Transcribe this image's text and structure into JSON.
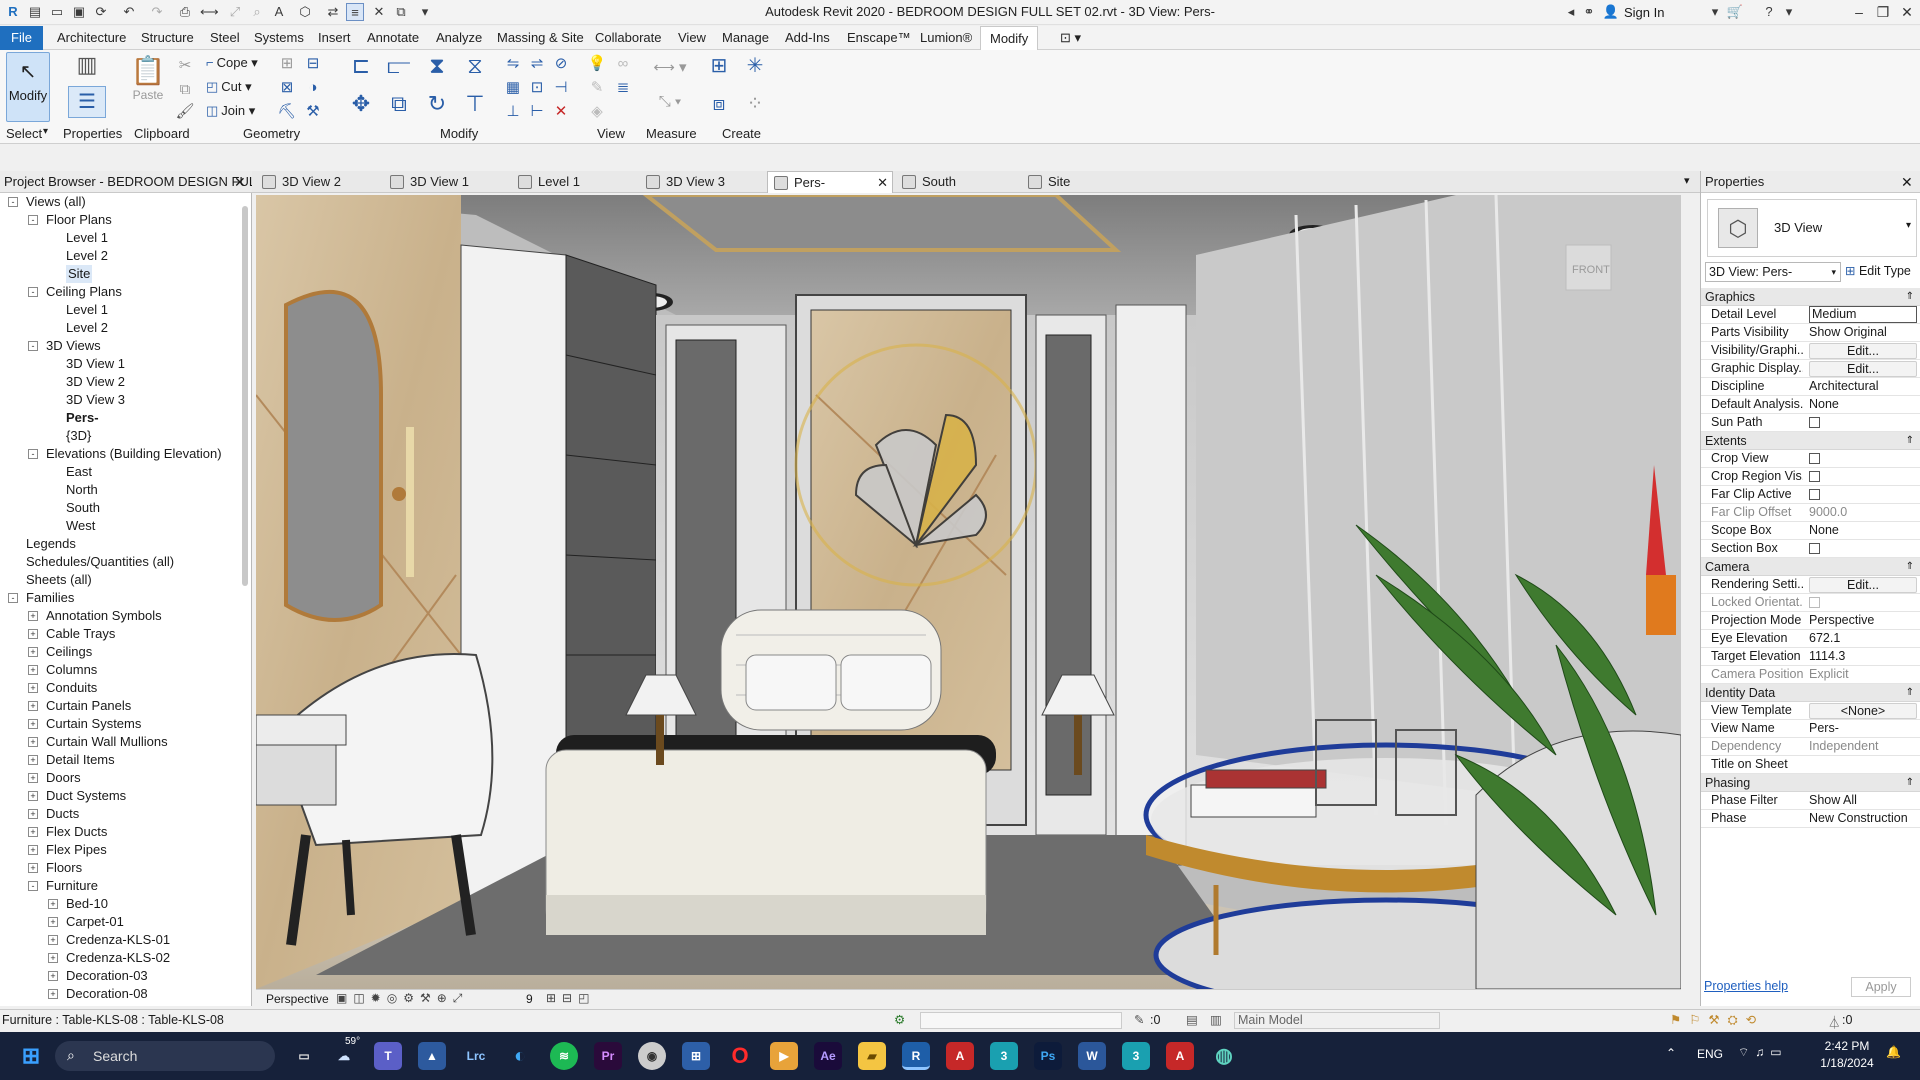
{
  "app": {
    "title": "Autodesk Revit 2020 - BEDROOM DESIGN FULL SET 02.rvt - 3D View: Pers-",
    "sign_in": "Sign In"
  },
  "ribbon": {
    "tabs": [
      "File",
      "Architecture",
      "Structure",
      "Steel",
      "Systems",
      "Insert",
      "Annotate",
      "Analyze",
      "Massing & Site",
      "Collaborate",
      "View",
      "Manage",
      "Add-Ins",
      "Enscape™",
      "Lumion®",
      "Modify"
    ],
    "active_tab": "Modify",
    "modify_label": "Modify",
    "paste_label": "Paste",
    "properties_label": "Properties",
    "cope": "Cope",
    "cut": "Cut",
    "join": "Join",
    "panels": {
      "select": "Select",
      "properties": "Properties",
      "clipboard": "Clipboard",
      "geometry": "Geometry",
      "modify": "Modify",
      "view": "View",
      "measure": "Measure",
      "create": "Create"
    }
  },
  "project_browser": {
    "title": "Project Browser - BEDROOM DESIGN FUL...",
    "items": [
      {
        "label": "Views (all)",
        "level": 0,
        "toggle": "-"
      },
      {
        "label": "Floor Plans",
        "level": 1,
        "toggle": "-"
      },
      {
        "label": "Level 1",
        "level": 2
      },
      {
        "label": "Level 2",
        "level": 2
      },
      {
        "label": "Site",
        "level": 2,
        "selected": true
      },
      {
        "label": "Ceiling Plans",
        "level": 1,
        "toggle": "-"
      },
      {
        "label": "Level 1",
        "level": 2
      },
      {
        "label": "Level 2",
        "level": 2
      },
      {
        "label": "3D Views",
        "level": 1,
        "toggle": "-"
      },
      {
        "label": "3D View 1",
        "level": 2
      },
      {
        "label": "3D View 2",
        "level": 2
      },
      {
        "label": "3D View 3",
        "level": 2
      },
      {
        "label": "Pers-",
        "level": 2,
        "bold": true
      },
      {
        "label": "{3D}",
        "level": 2
      },
      {
        "label": "Elevations (Building Elevation)",
        "level": 1,
        "toggle": "-"
      },
      {
        "label": "East",
        "level": 2
      },
      {
        "label": "North",
        "level": 2
      },
      {
        "label": "South",
        "level": 2
      },
      {
        "label": "West",
        "level": 2
      },
      {
        "label": "Legends",
        "level": 0
      },
      {
        "label": "Schedules/Quantities (all)",
        "level": 0
      },
      {
        "label": "Sheets (all)",
        "level": 0
      },
      {
        "label": "Families",
        "level": 0,
        "toggle": "-"
      },
      {
        "label": "Annotation Symbols",
        "level": 1,
        "toggle": "+"
      },
      {
        "label": "Cable Trays",
        "level": 1,
        "toggle": "+"
      },
      {
        "label": "Ceilings",
        "level": 1,
        "toggle": "+"
      },
      {
        "label": "Columns",
        "level": 1,
        "toggle": "+"
      },
      {
        "label": "Conduits",
        "level": 1,
        "toggle": "+"
      },
      {
        "label": "Curtain Panels",
        "level": 1,
        "toggle": "+"
      },
      {
        "label": "Curtain Systems",
        "level": 1,
        "toggle": "+"
      },
      {
        "label": "Curtain Wall Mullions",
        "level": 1,
        "toggle": "+"
      },
      {
        "label": "Detail Items",
        "level": 1,
        "toggle": "+"
      },
      {
        "label": "Doors",
        "level": 1,
        "toggle": "+"
      },
      {
        "label": "Duct Systems",
        "level": 1,
        "toggle": "+"
      },
      {
        "label": "Ducts",
        "level": 1,
        "toggle": "+"
      },
      {
        "label": "Flex Ducts",
        "level": 1,
        "toggle": "+"
      },
      {
        "label": "Flex Pipes",
        "level": 1,
        "toggle": "+"
      },
      {
        "label": "Floors",
        "level": 1,
        "toggle": "+"
      },
      {
        "label": "Furniture",
        "level": 1,
        "toggle": "-"
      },
      {
        "label": "Bed-10",
        "level": 2,
        "toggle": "+"
      },
      {
        "label": "Carpet-01",
        "level": 2,
        "toggle": "+"
      },
      {
        "label": "Credenza-KLS-01",
        "level": 2,
        "toggle": "+"
      },
      {
        "label": "Credenza-KLS-02",
        "level": 2,
        "toggle": "+"
      },
      {
        "label": "Decoration-03",
        "level": 2,
        "toggle": "+"
      },
      {
        "label": "Decoration-08",
        "level": 2,
        "toggle": "+"
      }
    ]
  },
  "view_tabs": [
    {
      "label": "3D View 2"
    },
    {
      "label": "3D View 1"
    },
    {
      "label": "Level 1"
    },
    {
      "label": "3D View 3"
    },
    {
      "label": "Pers-",
      "active": true
    },
    {
      "label": "South"
    },
    {
      "label": "Site"
    }
  ],
  "viewport": {
    "viewcube_label": "FRONT",
    "status_label": "Perspective",
    "status_scale": "9"
  },
  "properties": {
    "title": "Properties",
    "type_name": "3D View",
    "view_selector": "3D View: Pers-",
    "edit_type": "Edit Type",
    "help": "Properties help",
    "apply": "Apply",
    "rows": [
      {
        "group": "Graphics"
      },
      {
        "k": "Detail Level",
        "v": "Medium",
        "style": "field"
      },
      {
        "k": "Parts Visibility",
        "v": "Show Original"
      },
      {
        "k": "Visibility/Graphi...",
        "v": "Edit...",
        "style": "button"
      },
      {
        "k": "Graphic Display...",
        "v": "Edit...",
        "style": "button"
      },
      {
        "k": "Discipline",
        "v": "Architectural"
      },
      {
        "k": "Default Analysis...",
        "v": "None"
      },
      {
        "k": "Sun Path",
        "v": "",
        "style": "check"
      },
      {
        "group": "Extents"
      },
      {
        "k": "Crop View",
        "v": "",
        "style": "check"
      },
      {
        "k": "Crop Region Vis...",
        "v": "",
        "style": "check"
      },
      {
        "k": "Far Clip Active",
        "v": "",
        "style": "check"
      },
      {
        "k": "Far Clip Offset",
        "v": "9000.0",
        "style": "grey"
      },
      {
        "k": "Scope Box",
        "v": "None"
      },
      {
        "k": "Section Box",
        "v": "",
        "style": "check"
      },
      {
        "group": "Camera"
      },
      {
        "k": "Rendering Setti...",
        "v": "Edit...",
        "style": "button"
      },
      {
        "k": "Locked Orientat...",
        "v": "",
        "style": "greycheck"
      },
      {
        "k": "Projection Mode",
        "v": "Perspective"
      },
      {
        "k": "Eye Elevation",
        "v": "672.1"
      },
      {
        "k": "Target Elevation",
        "v": "1114.3"
      },
      {
        "k": "Camera Position",
        "v": "Explicit",
        "style": "grey"
      },
      {
        "group": "Identity Data"
      },
      {
        "k": "View Template",
        "v": "<None>",
        "style": "button"
      },
      {
        "k": "View Name",
        "v": "Pers-"
      },
      {
        "k": "Dependency",
        "v": "Independent",
        "style": "grey"
      },
      {
        "k": "Title on Sheet",
        "v": ""
      },
      {
        "group": "Phasing"
      },
      {
        "k": "Phase Filter",
        "v": "Show All"
      },
      {
        "k": "Phase",
        "v": "New Construction"
      }
    ]
  },
  "statusbar": {
    "selection": "Furniture : Table-KLS-08 : Table-KLS-08",
    "count": ":0",
    "model": "Main Model",
    "filter_count": ":0"
  },
  "taskbar": {
    "search": "Search",
    "weather": "59°",
    "lang": "ENG",
    "time": "2:42 PM",
    "date": "1/18/2024"
  },
  "colors": {
    "file_tab": "#1f6fbf",
    "taskbar": "#16213a",
    "accent": "#2a5ea8"
  }
}
